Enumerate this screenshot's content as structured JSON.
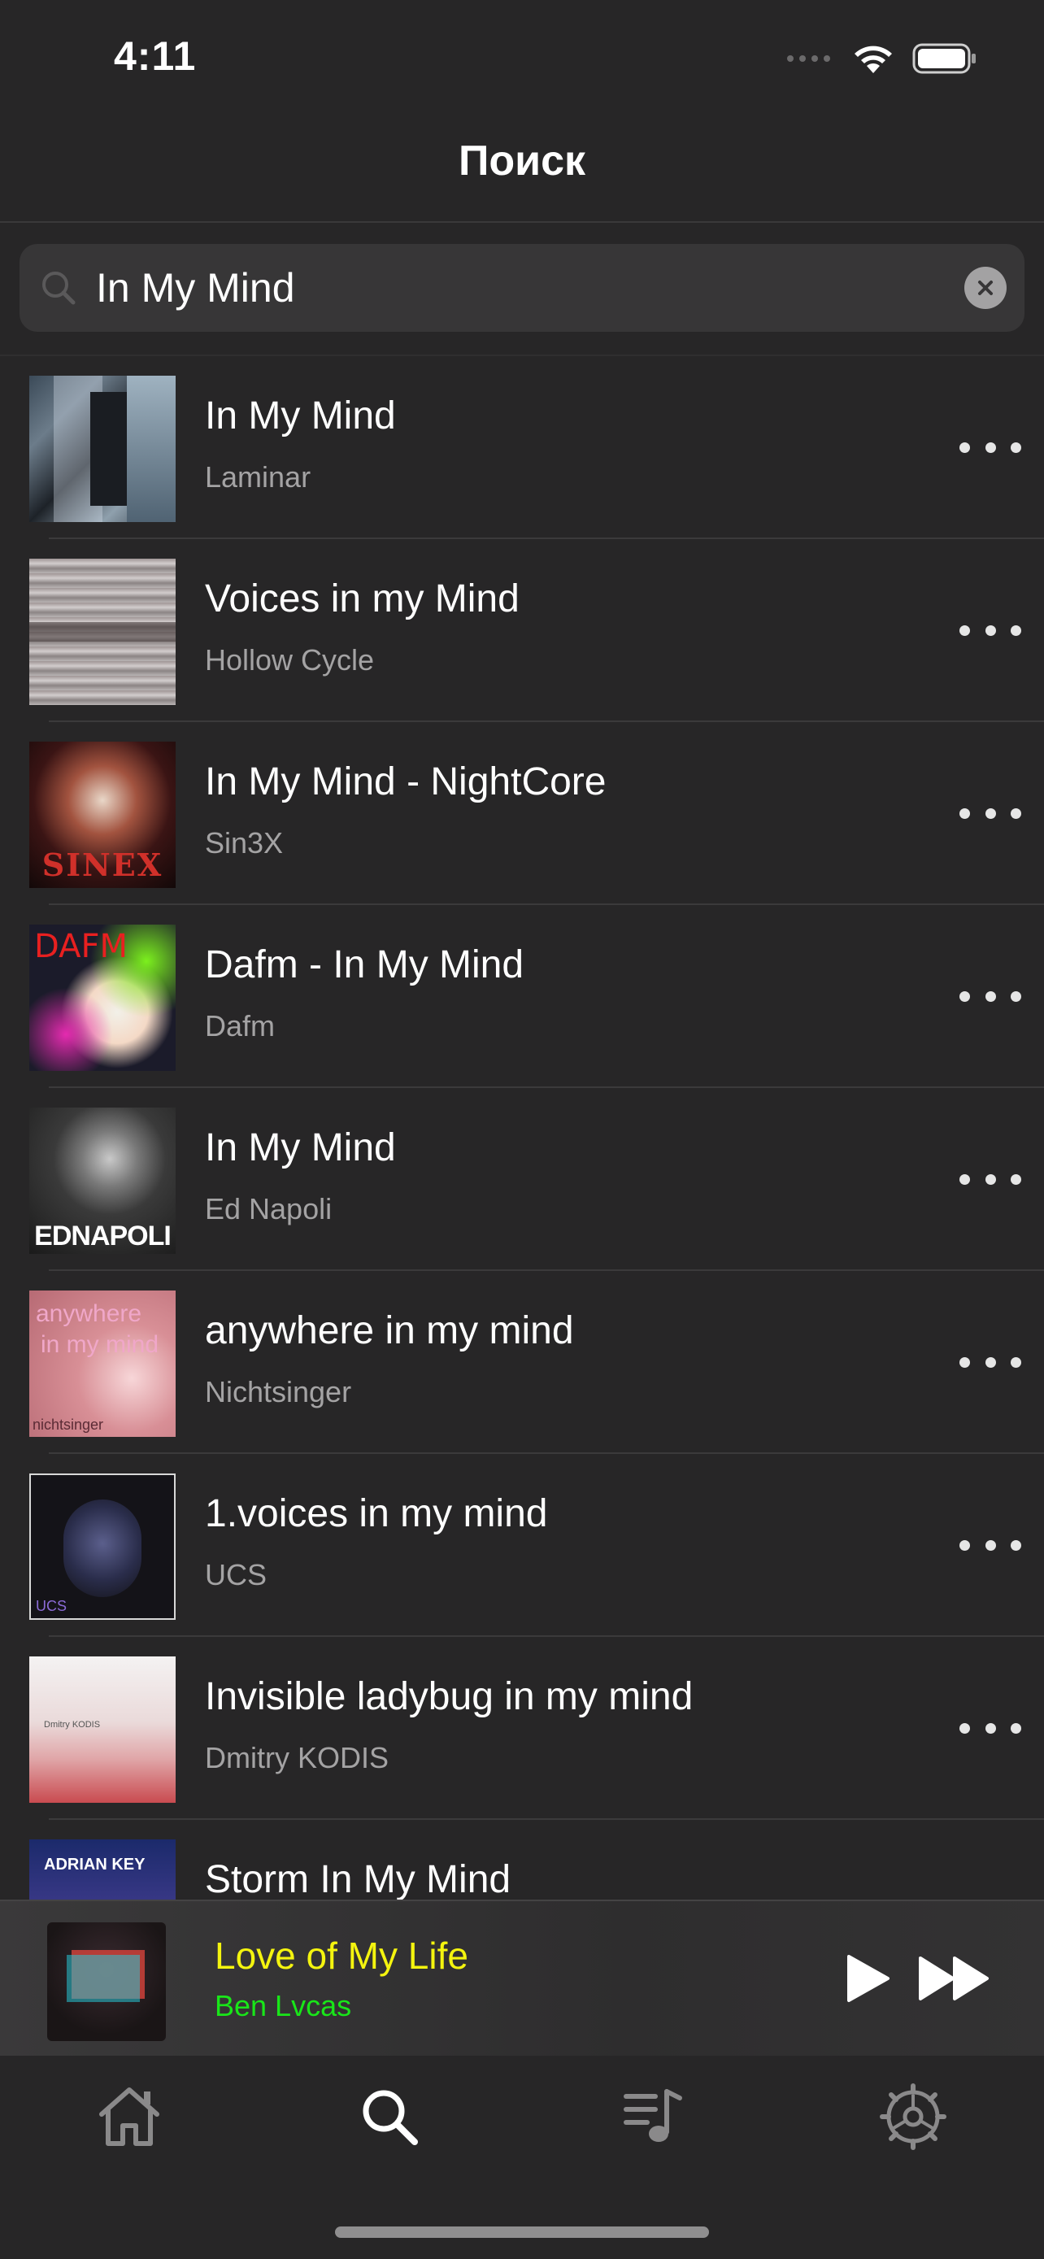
{
  "status_bar": {
    "time": "4:11"
  },
  "nav": {
    "title": "Поиск"
  },
  "search": {
    "value": "In My Mind"
  },
  "results": [
    {
      "title": "In My Mind",
      "artist": "Laminar"
    },
    {
      "title": "Voices in my Mind",
      "artist": "Hollow Cycle"
    },
    {
      "title": "In My Mind - NightCore",
      "artist": "Sin3X",
      "art_text": "SINEX"
    },
    {
      "title": "Dafm - In My Mind",
      "artist": "Dafm",
      "art_text": "DAFM"
    },
    {
      "title": "In My Mind",
      "artist": "Ed Napoli",
      "art_text": "EDNAPOLI"
    },
    {
      "title": "anywhere in my mind",
      "artist": "Nichtsinger",
      "art_text_1": "anywhere",
      "art_text_2": "in my mind",
      "art_text_3": "nichtsinger"
    },
    {
      "title": "1.voices in my mind",
      "artist": "UCS",
      "art_text": "UCS"
    },
    {
      "title": "Invisible ladybug in my mind",
      "artist": "Dmitry KODIS",
      "art_text": "Dmitry KODIS"
    },
    {
      "title": "Storm In My Mind",
      "artist": "",
      "art_text": "ADRIAN KEY"
    }
  ],
  "now_playing": {
    "title": "Love of My Life",
    "artist": "Ben Lvcas",
    "title_color": "#f4f40f",
    "artist_color": "#19e619"
  },
  "tabs": [
    {
      "icon": "home-icon",
      "active": false
    },
    {
      "icon": "search-icon",
      "active": true
    },
    {
      "icon": "playlist-icon",
      "active": false
    },
    {
      "icon": "settings-icon",
      "active": false
    }
  ]
}
